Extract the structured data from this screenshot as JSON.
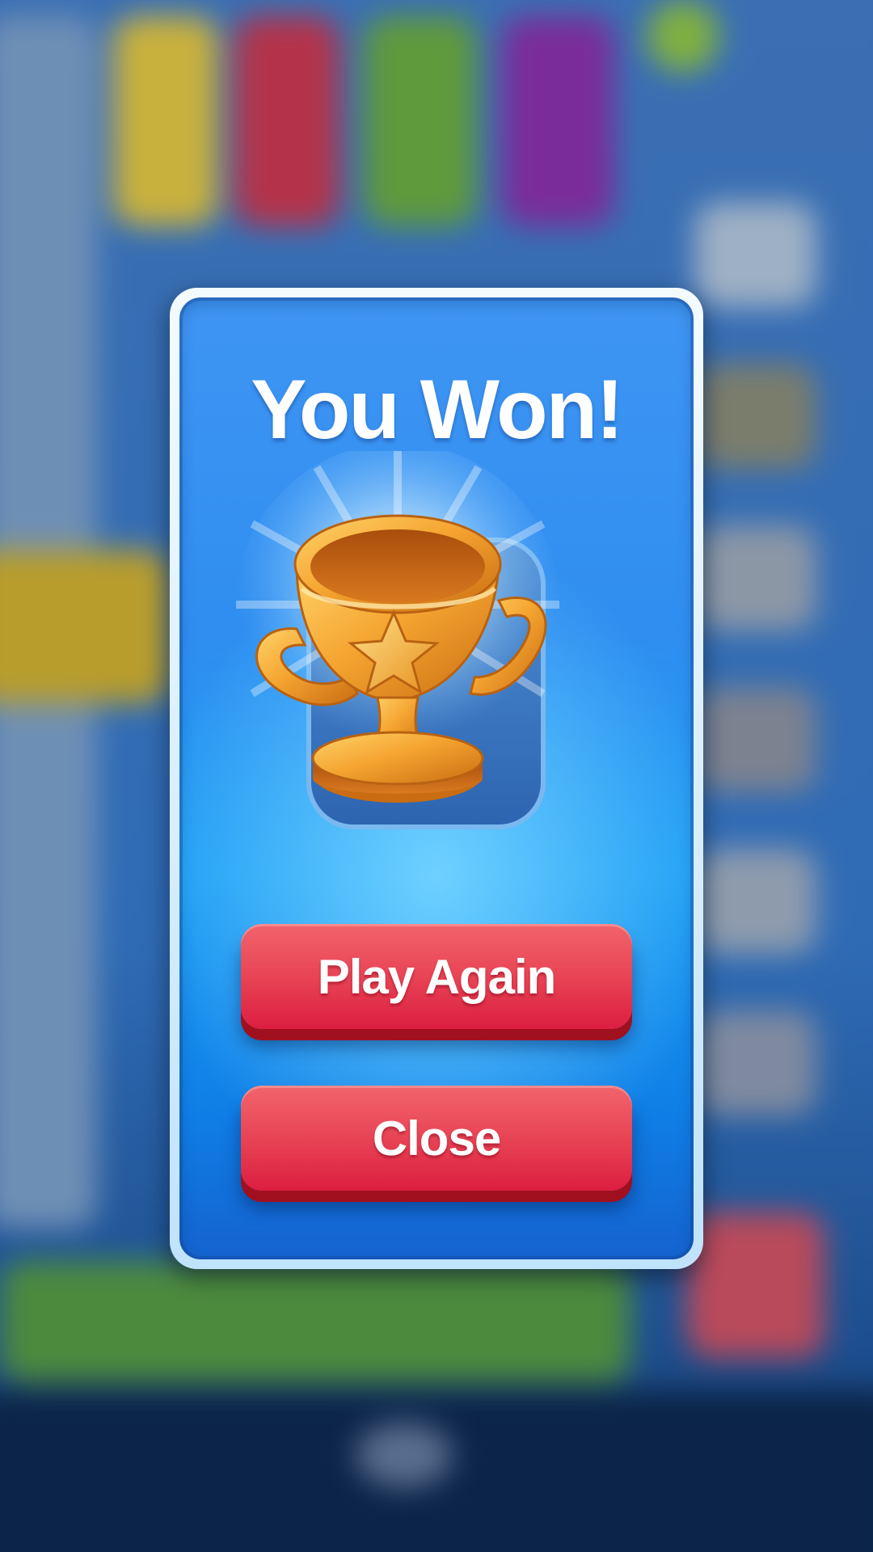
{
  "dialog": {
    "title": "You Won!",
    "icon": "trophy-icon",
    "buttons": {
      "play_again": "Play Again",
      "close": "Close"
    }
  },
  "colors": {
    "dialog_blue": "#2f8ef0",
    "button_red": "#e84455",
    "trophy_gold": "#f0a030"
  }
}
